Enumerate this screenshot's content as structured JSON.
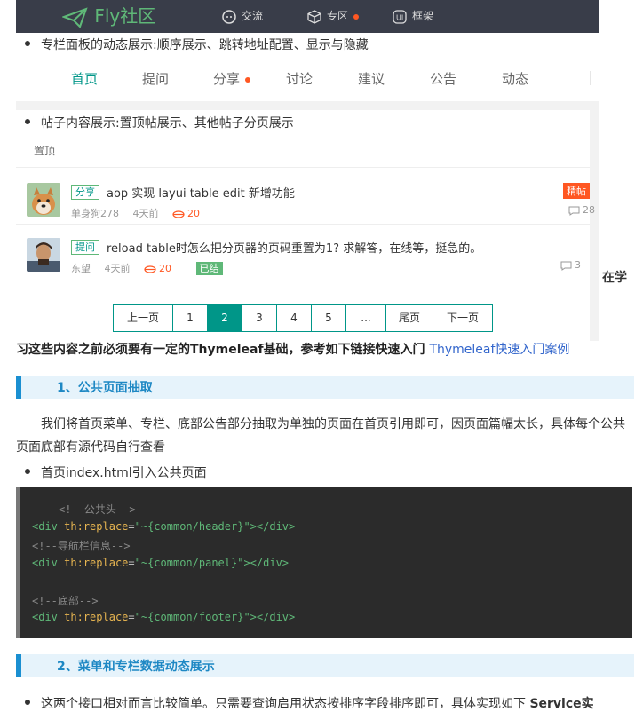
{
  "header": {
    "logo_text": "Fly社区",
    "nav": [
      {
        "label": "交流",
        "icon": "chat-icon"
      },
      {
        "label": "专区",
        "icon": "cube-icon",
        "dot": true
      },
      {
        "label": "框架",
        "icon": "ui-icon"
      }
    ]
  },
  "bullets": {
    "b1": "专栏面板的动态展示:顺序展示、跳转地址配置、显示与隐藏",
    "b2": "帖子内容展示:置顶帖展示、其他帖子分页展示",
    "b3": "首页index.html引入公共页面",
    "b4_text": "这两个接口相对而言比较简单。只需要查询启用状态按排序字段排序即可，具体实现如下 ",
    "b4_bold": "Service实"
  },
  "colnav": {
    "tabs": [
      "首页",
      "提问",
      "分享",
      "讨论",
      "建议",
      "公告",
      "动态"
    ],
    "active_index": 0,
    "dot_index": 2
  },
  "posts": {
    "section_label": "置顶",
    "items": [
      {
        "tag": "分享",
        "title": "aop 实现 layui table edit 新增功能",
        "author": "单身狗278",
        "time": "4天前",
        "exp": "20",
        "badge": "精帖",
        "comments": "28"
      },
      {
        "tag": "提问",
        "title": "reload table时怎么把分页器的页码重置为1? 求解答，在线等，挺急的。",
        "author": "东望",
        "time": "4天前",
        "exp": "20",
        "status": "已结",
        "comments": "3"
      }
    ]
  },
  "pager": {
    "items": [
      "上一页",
      "1",
      "2",
      "3",
      "4",
      "5",
      "...",
      "尾页",
      "下一页"
    ],
    "current": "2"
  },
  "article": {
    "side_text": "在学",
    "intro_bold": "习这些内容之前必须要有一定的Thymeleaf基础，参考如下链接快速入门 ",
    "intro_link": "Thymeleaf快速入门案例",
    "h1": "1、公共页面抽取",
    "p1": "我们将首页菜单、专栏、底部公告部分抽取为单独的页面在首页引用即可，因页面篇幅太长，具体每个公共页面底部有源代码自行查看",
    "h2": "2、菜单和专栏数据动态展示"
  },
  "code": {
    "c1": "<!--公共头-->",
    "c2": "<!--导航栏信息-->",
    "c3": "<!--底部-->",
    "tag_open": "<div",
    "attr": "th:replace",
    "eq": "=",
    "v1": "\"~{common/header}\"",
    "v2": "\"~{common/panel}\"",
    "v3": "\"~{common/footer}\"",
    "tag_close": "></div>"
  }
}
